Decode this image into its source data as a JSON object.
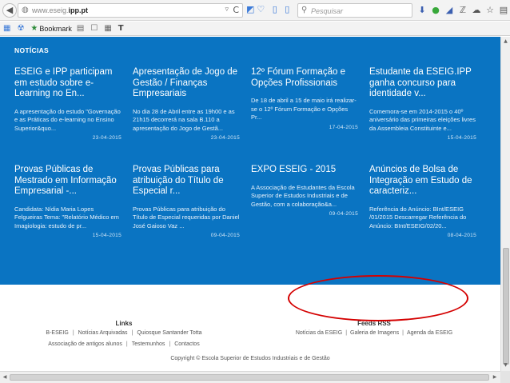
{
  "browser": {
    "url_prefix": "www.eseig.",
    "url_domain": "ipp.pt",
    "search_placeholder": "Pesquisar",
    "back_glyph": "◀",
    "dropdown_glyph": "▿",
    "reload_glyph": "C",
    "ext_icons": "◩♡ ▯ ▯",
    "toolbar_icons": [
      "⬇",
      "●",
      "◢",
      "ℤ",
      "☁",
      "☆",
      "▤",
      "▣",
      "≡"
    ]
  },
  "bookmarks_bar": {
    "items": [
      {
        "glyph": "▦",
        "label": ""
      },
      {
        "glyph": "☢",
        "label": ""
      },
      {
        "glyph": "★",
        "label": "Bookmark"
      },
      {
        "glyph": "▤",
        "label": ""
      },
      {
        "glyph": "☐",
        "label": ""
      },
      {
        "glyph": "▦",
        "label": ""
      },
      {
        "glyph": "T",
        "label": ""
      }
    ]
  },
  "news": {
    "section_title": "NOTÍCIAS",
    "items": [
      {
        "title": "ESEIG e IPP participam em estudo sobre e-Learning no En...",
        "body": "A apresentação do estudo \"Governação e as Práticas do e-learning no Ensino Superior&quo...",
        "date": "23-04-2015"
      },
      {
        "title": "Apresentação de Jogo de Gestão / Finanças Empresariais",
        "body": "No dia 28 de Abril entre as 19h00 e as 21h15 decorrerá na sala B.110 a apresentação do Jogo de Gestã...",
        "date": "23-04-2015"
      },
      {
        "title": "12º Fórum Formação e Opções Profissionais",
        "body": "De 18 de abril a 15 de maio irá realizar-se o 12º Fórum Formação e Opções Pr...",
        "date": "17-04-2015"
      },
      {
        "title": "Estudante da ESEIG.IPP ganha concurso para identidade v...",
        "body": "Comemora-se em 2014-2015 o 40º aniversário das primeiras eleições livres da Assembleia Constituinte e...",
        "date": "15-04-2015"
      },
      {
        "title": "Provas Públicas de Mestrado em Informação Empresarial -...",
        "body": "Candidata: Nídia Maria Lopes Felgueiras Tema: \"Relatório Médico em Imagiologia: estudo de pr...",
        "date": "15-04-2015"
      },
      {
        "title": "Provas Públicas para atribuição do Título de Especial r...",
        "body": "Provas Públicas para atribuição do Título de Especial requeridas por Daniel José Gaioso Vaz ...",
        "date": "09-04-2015"
      },
      {
        "title": "EXPO ESEIG - 2015",
        "body": "A Associação de Estudantes da Escola Superior de Estudos Industriais e de Gestão, com a colaboração&a...",
        "date": "09-04-2015"
      },
      {
        "title": "Anúncios de Bolsa de Integração em Estudo de caracteriz...",
        "body": "Referência do Anúncio: BInt/ESEIG /01/2015 Descarregar Referência do Anúncio: BInt/ESEIG/02/20...",
        "date": "08-04-2015"
      }
    ]
  },
  "footer": {
    "links_title": "Links",
    "links_row1": [
      "B-ESEIG",
      "Notícias Arquivadas",
      "Quiosque Santander Totta"
    ],
    "links_row2": [
      "Associação de antigos alunos",
      "Testemunhos",
      "Contactos"
    ],
    "feeds_title": "Feeds RSS",
    "feeds": [
      "Notícias da ESEIG",
      "Galeria de Imagens",
      "Agenda da ESEIG"
    ],
    "copyright": "Copyright © Escola Superior de Estudos Industriais e de Gestão"
  },
  "colors": {
    "news_background": "#0a74c2",
    "annotation": "#d40000"
  }
}
